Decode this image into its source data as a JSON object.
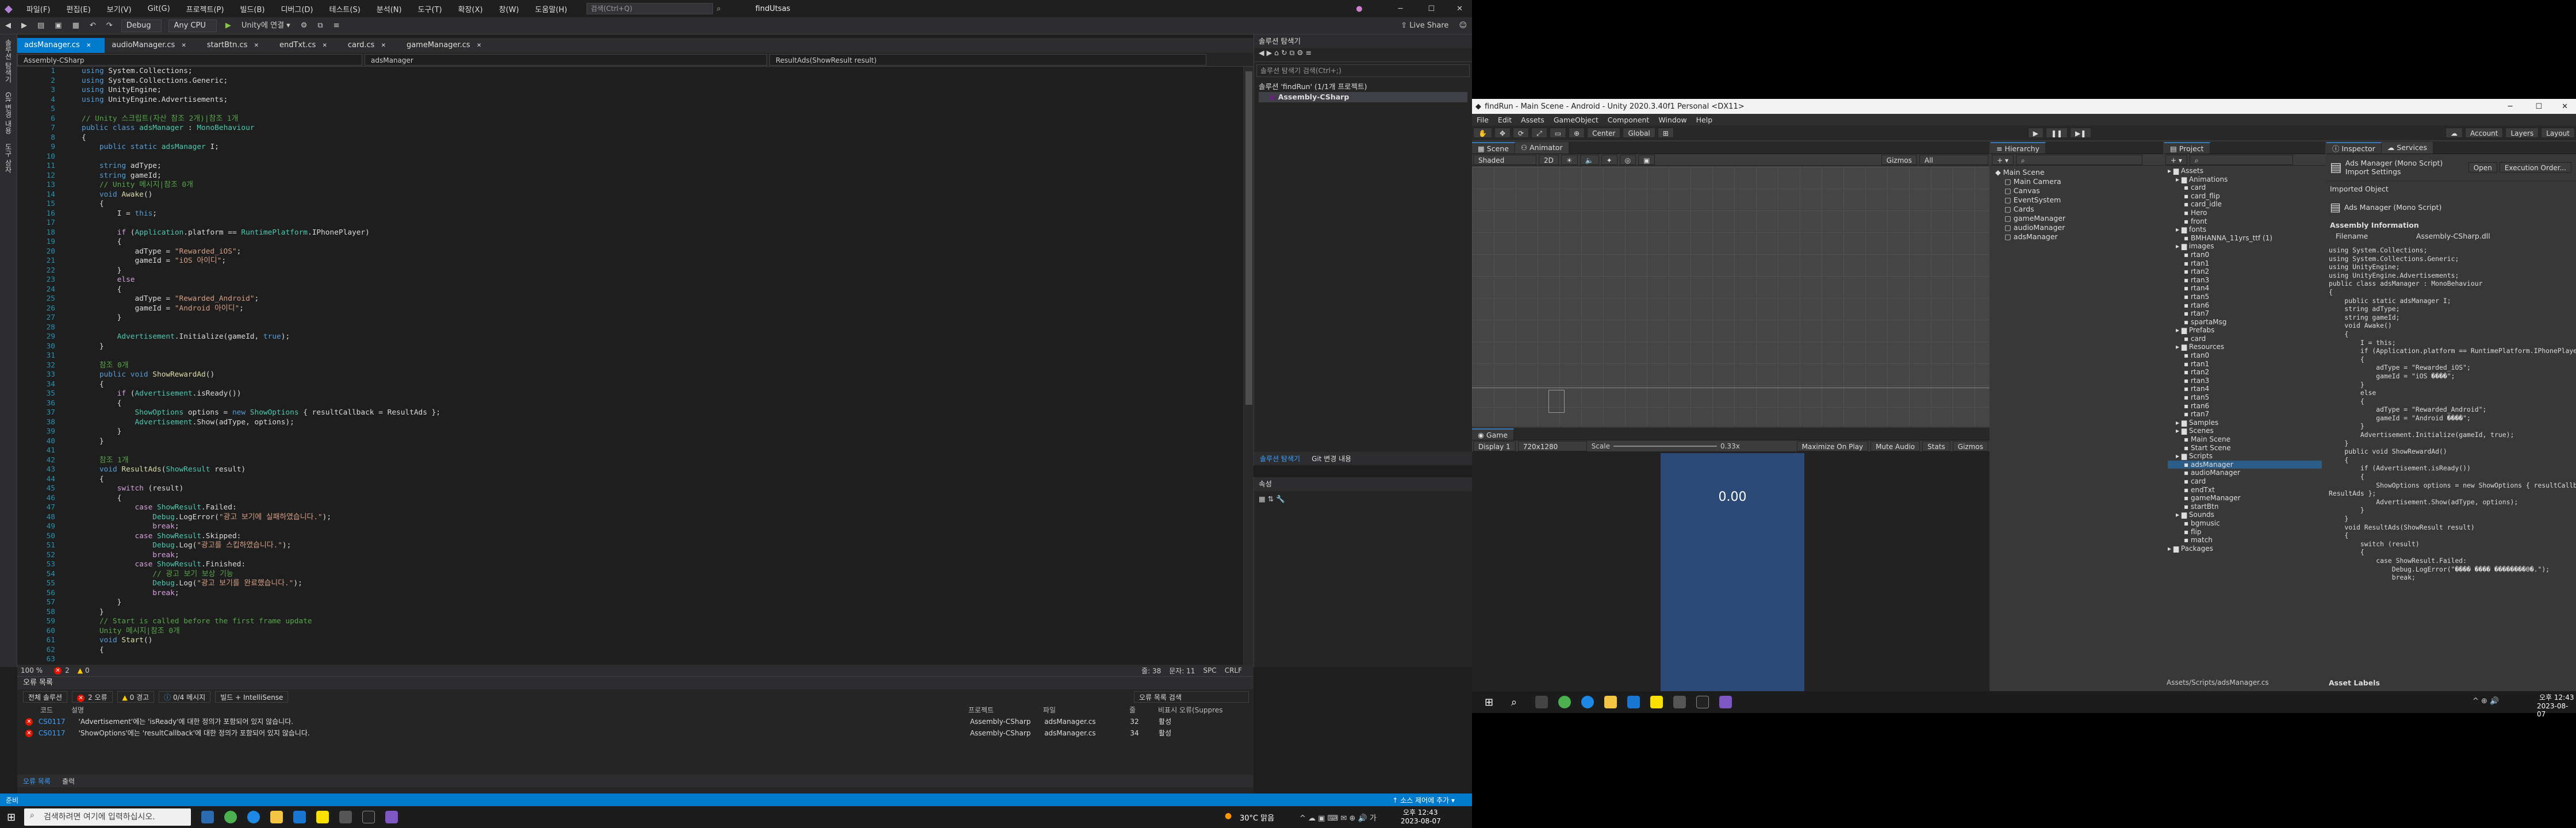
{
  "vs": {
    "title": "findUtsas",
    "menu": [
      "파일(F)",
      "편집(E)",
      "보기(V)",
      "Git(G)",
      "프로젝트(P)",
      "빌드(B)",
      "디버그(D)",
      "테스트(S)",
      "분석(N)",
      "도구(T)",
      "확장(X)",
      "창(W)",
      "도움말(H)"
    ],
    "search_placeholder": "검색(Ctrl+Q)",
    "toolbar": {
      "config": "Debug",
      "platform": "Any CPU",
      "attach": "Unity에 연결 ▾",
      "live_share": "Live Share"
    },
    "side_tabs": [
      "솔루션 탐색기",
      "Git 변경 내용",
      "도구 상자"
    ],
    "tabs": [
      "adsManager.cs",
      "audioManager.cs",
      "startBtn.cs",
      "endTxt.cs",
      "card.cs",
      "gameManager.cs"
    ],
    "nav": {
      "project": "Assembly-CSharp",
      "class": "adsManager",
      "member": "ResultAds(ShowResult result)"
    },
    "line_count": 63,
    "code_lines": [
      [
        [
          "k",
          "using "
        ],
        [
          "",
          "System.Collections;"
        ]
      ],
      [
        [
          "k",
          "using "
        ],
        [
          "",
          "System.Collections.Generic;"
        ]
      ],
      [
        [
          "k",
          "using "
        ],
        [
          "",
          "UnityEngine;"
        ]
      ],
      [
        [
          "k",
          "using "
        ],
        [
          "",
          "UnityEngine.Advertisements;"
        ]
      ],
      [
        [
          "",
          ""
        ]
      ],
      [
        [
          "c",
          "// Unity 스크립트(자산 참조 2개)|참조 1개"
        ]
      ],
      [
        [
          "k",
          "public class "
        ],
        [
          "t",
          "adsManager"
        ],
        [
          "",
          " : "
        ],
        [
          "t",
          "MonoBehaviour"
        ]
      ],
      [
        [
          "",
          "{"
        ]
      ],
      [
        [
          "",
          "    "
        ],
        [
          "k",
          "public static "
        ],
        [
          "t",
          "adsManager "
        ],
        [
          "",
          "I;"
        ]
      ],
      [
        [
          "",
          ""
        ]
      ],
      [
        [
          "",
          "    "
        ],
        [
          "k",
          "string "
        ],
        [
          "",
          "adType;"
        ]
      ],
      [
        [
          "",
          "    "
        ],
        [
          "k",
          "string "
        ],
        [
          "",
          "gameId;"
        ]
      ],
      [
        [
          "c",
          "    // Unity 메시지|참조 0개"
        ]
      ],
      [
        [
          "",
          "    "
        ],
        [
          "k",
          "void "
        ],
        [
          "m",
          "Awake"
        ],
        [
          "",
          "()"
        ]
      ],
      [
        [
          "",
          "    {"
        ]
      ],
      [
        [
          "",
          "        I = "
        ],
        [
          "k",
          "this"
        ],
        [
          "",
          ";"
        ]
      ],
      [
        [
          "",
          ""
        ]
      ],
      [
        [
          "",
          "        "
        ],
        [
          "p",
          "if "
        ],
        [
          "",
          "("
        ],
        [
          "t",
          "Application"
        ],
        [
          "",
          ".platform == "
        ],
        [
          "t",
          "RuntimePlatform"
        ],
        [
          "",
          ".IPhonePlayer)"
        ]
      ],
      [
        [
          "",
          "        {"
        ]
      ],
      [
        [
          "",
          "            adType = "
        ],
        [
          "s",
          "\"Rewarded_iOS\""
        ],
        [
          "",
          ";"
        ]
      ],
      [
        [
          "",
          "            gameId = "
        ],
        [
          "s",
          "\"iOS 아이디\""
        ],
        [
          "",
          ";"
        ]
      ],
      [
        [
          "",
          "        }"
        ]
      ],
      [
        [
          "",
          "        "
        ],
        [
          "p",
          "else"
        ]
      ],
      [
        [
          "",
          "        {"
        ]
      ],
      [
        [
          "",
          "            adType = "
        ],
        [
          "s",
          "\"Rewarded_Android\""
        ],
        [
          "",
          ";"
        ]
      ],
      [
        [
          "",
          "            gameId = "
        ],
        [
          "s",
          "\"Android 아이디\""
        ],
        [
          "",
          ";"
        ]
      ],
      [
        [
          "",
          "        }"
        ]
      ],
      [
        [
          "",
          ""
        ]
      ],
      [
        [
          "",
          "        "
        ],
        [
          "t",
          "Advertisement"
        ],
        [
          "",
          ".Initialize(gameId, "
        ],
        [
          "k",
          "true"
        ],
        [
          "",
          ");"
        ]
      ],
      [
        [
          "",
          "    }"
        ]
      ],
      [
        [
          "",
          ""
        ]
      ],
      [
        [
          "c",
          "    참조 0개"
        ]
      ],
      [
        [
          "",
          "    "
        ],
        [
          "k",
          "public void "
        ],
        [
          "m",
          "ShowRewardAd"
        ],
        [
          "",
          "()"
        ]
      ],
      [
        [
          "",
          "    {"
        ]
      ],
      [
        [
          "",
          "        "
        ],
        [
          "p",
          "if "
        ],
        [
          "",
          "("
        ],
        [
          "t",
          "Advertisement"
        ],
        [
          "",
          ".isReady())"
        ]
      ],
      [
        [
          "",
          "        {"
        ]
      ],
      [
        [
          "",
          "            "
        ],
        [
          "t",
          "ShowOptions "
        ],
        [
          "",
          "options = "
        ],
        [
          "k",
          "new "
        ],
        [
          "t",
          "ShowOptions "
        ],
        [
          "",
          "{ resultCallback = ResultAds };"
        ]
      ],
      [
        [
          "",
          "            "
        ],
        [
          "t",
          "Advertisement"
        ],
        [
          "",
          ".Show(adType, options);"
        ]
      ],
      [
        [
          "",
          "        }"
        ]
      ],
      [
        [
          "",
          "    }"
        ]
      ],
      [
        [
          "",
          ""
        ]
      ],
      [
        [
          "c",
          "    참조 1개"
        ]
      ],
      [
        [
          "",
          "    "
        ],
        [
          "k",
          "void "
        ],
        [
          "m",
          "ResultAds"
        ],
        [
          "",
          "("
        ],
        [
          "t",
          "ShowResult "
        ],
        [
          "",
          "result)"
        ]
      ],
      [
        [
          "",
          "    {"
        ]
      ],
      [
        [
          "",
          "        "
        ],
        [
          "p",
          "switch "
        ],
        [
          "",
          "(result)"
        ]
      ],
      [
        [
          "",
          "        {"
        ]
      ],
      [
        [
          "",
          "            "
        ],
        [
          "p",
          "case "
        ],
        [
          "t",
          "ShowResult"
        ],
        [
          "",
          ".Failed:"
        ]
      ],
      [
        [
          "",
          "                "
        ],
        [
          "t",
          "Debug"
        ],
        [
          "",
          ".LogError("
        ],
        [
          "s",
          "\"광고 보기에 실패하였습니다.\""
        ],
        [
          "",
          ");"
        ]
      ],
      [
        [
          "",
          "                "
        ],
        [
          "p",
          "break"
        ],
        [
          "",
          ";"
        ]
      ],
      [
        [
          "",
          "            "
        ],
        [
          "p",
          "case "
        ],
        [
          "t",
          "ShowResult"
        ],
        [
          "",
          ".Skipped:"
        ]
      ],
      [
        [
          "",
          "                "
        ],
        [
          "t",
          "Debug"
        ],
        [
          "",
          ".Log("
        ],
        [
          "s",
          "\"광고를 스킵하였습니다.\""
        ],
        [
          "",
          ");"
        ]
      ],
      [
        [
          "",
          "                "
        ],
        [
          "p",
          "break"
        ],
        [
          "",
          ";"
        ]
      ],
      [
        [
          "",
          "            "
        ],
        [
          "p",
          "case "
        ],
        [
          "t",
          "ShowResult"
        ],
        [
          "",
          ".Finished:"
        ]
      ],
      [
        [
          "c",
          "                // 광고 보기 보상 기능"
        ]
      ],
      [
        [
          "",
          "                "
        ],
        [
          "t",
          "Debug"
        ],
        [
          "",
          ".Log("
        ],
        [
          "s",
          "\"광고 보기를 완료했습니다.\""
        ],
        [
          "",
          ");"
        ]
      ],
      [
        [
          "",
          "                "
        ],
        [
          "p",
          "break"
        ],
        [
          "",
          ";"
        ]
      ],
      [
        [
          "",
          "        }"
        ]
      ],
      [
        [
          "",
          "    }"
        ]
      ],
      [
        [
          "c",
          "    // Start is called before the first frame update"
        ]
      ],
      [
        [
          "c",
          "    Unity 메시지|참조 0개"
        ]
      ],
      [
        [
          "",
          "    "
        ],
        [
          "k",
          "void "
        ],
        [
          "m",
          "Start"
        ],
        [
          "",
          "()"
        ]
      ],
      [
        [
          "",
          "    {"
        ]
      ],
      [
        [
          "",
          ""
        ]
      ],
      [
        [
          "",
          "    }"
        ]
      ]
    ],
    "editor_status": {
      "zoom": "100 %",
      "errors": "2",
      "warnings": "0",
      "line": "줄: 38",
      "col": "문자: 11",
      "enc": "SPC",
      "eol": "CRLF"
    },
    "errors": {
      "title": "오류 목록",
      "scope": "전체 솔루션",
      "err_count": "2 오류",
      "warn_count": "0 경고",
      "msg_count": "0/4 메시지",
      "build": "빌드 + IntelliSense",
      "search_placeholder": "오류 목록 검색",
      "cols": [
        "코드",
        "설명",
        "프로젝트",
        "파일",
        "줄",
        "비표시 오류(Suppres"
      ],
      "rows": [
        {
          "code": "CS0117",
          "desc": "'Advertisement'에는 'isReady'에 대한 정의가 포함되어 있지 않습니다.",
          "proj": "Assembly-CSharp",
          "file": "adsManager.cs",
          "line": "32",
          "state": "활성"
        },
        {
          "code": "CS0117",
          "desc": "'ShowOptions'에는 'resultCallback'에 대한 정의가 포함되어 있지 않습니다.",
          "proj": "Assembly-CSharp",
          "file": "adsManager.cs",
          "line": "34",
          "state": "활성"
        }
      ],
      "bottom_tabs": [
        "오류 목록",
        "출력"
      ]
    },
    "solution": {
      "title": "솔루션 탐색기",
      "search": "솔루션 탐색기 검색(Ctrl+;)",
      "root": "솔루션 'findRun' (1/1개 프로젝트)",
      "project": "Assembly-CSharp",
      "tabs": [
        "솔루션 탐색기",
        "Git 변경 내용"
      ]
    },
    "properties": {
      "title": "속성"
    },
    "status": {
      "left": "준비",
      "right": "↑ 소스 제어에 추가 ▾"
    }
  },
  "taskbar_left": {
    "search": "검색하려면 여기에 입력하십시오.",
    "weather": "30°C 맑음",
    "time": "오후 12:43",
    "date": "2023-08-07"
  },
  "unity": {
    "title": "findRun - Main Scene - Android - Unity 2020.3.40f1 Personal <DX11>",
    "menu": [
      "File",
      "Edit",
      "Assets",
      "GameObject",
      "Component",
      "Window",
      "Help"
    ],
    "tools": {
      "center": "Center",
      "global": "Global",
      "account": "Account",
      "layers": "Layers",
      "layout": "Layout"
    },
    "scene_tabs": [
      "Scene",
      "Animator"
    ],
    "scene_bar": {
      "shading": "Shaded",
      "mode": "2D",
      "gizmos": "Gizmos",
      "search": "All"
    },
    "game": {
      "tab": "Game",
      "display": "Display 1",
      "res": "720x1280",
      "scale_label": "Scale",
      "scale": "0.33x",
      "maximize": "Maximize On Play",
      "mute": "Mute Audio",
      "stats": "Stats",
      "gizmos": "Gizmos",
      "score": "0.00"
    },
    "hierarchy": {
      "title": "Hierarchy",
      "items": [
        {
          "t": "Main Scene",
          "d": 0
        },
        {
          "t": "Main Camera",
          "d": 1
        },
        {
          "t": "Canvas",
          "d": 1
        },
        {
          "t": "EventSystem",
          "d": 1
        },
        {
          "t": "Cards",
          "d": 1
        },
        {
          "t": "gameManager",
          "d": 1
        },
        {
          "t": "audioManager",
          "d": 1
        },
        {
          "t": "adsManager",
          "d": 1
        }
      ]
    },
    "project": {
      "title": "Project",
      "items": [
        {
          "t": "Assets",
          "d": 0
        },
        {
          "t": "Animations",
          "d": 1
        },
        {
          "t": "card",
          "d": 2
        },
        {
          "t": "card_flip",
          "d": 2
        },
        {
          "t": "card_idle",
          "d": 2
        },
        {
          "t": "Hero",
          "d": 2
        },
        {
          "t": "front",
          "d": 2
        },
        {
          "t": "fonts",
          "d": 1
        },
        {
          "t": "BMHANNA_11yrs_ttf (1)",
          "d": 2
        },
        {
          "t": "images",
          "d": 1
        },
        {
          "t": "rtan0",
          "d": 2
        },
        {
          "t": "rtan1",
          "d": 2
        },
        {
          "t": "rtan2",
          "d": 2
        },
        {
          "t": "rtan3",
          "d": 2
        },
        {
          "t": "rtan4",
          "d": 2
        },
        {
          "t": "rtan5",
          "d": 2
        },
        {
          "t": "rtan6",
          "d": 2
        },
        {
          "t": "rtan7",
          "d": 2
        },
        {
          "t": "spartaMsg",
          "d": 2
        },
        {
          "t": "Prefabs",
          "d": 1
        },
        {
          "t": "card",
          "d": 2
        },
        {
          "t": "Resources",
          "d": 1
        },
        {
          "t": "rtan0",
          "d": 2
        },
        {
          "t": "rtan1",
          "d": 2
        },
        {
          "t": "rtan2",
          "d": 2
        },
        {
          "t": "rtan3",
          "d": 2
        },
        {
          "t": "rtan4",
          "d": 2
        },
        {
          "t": "rtan5",
          "d": 2
        },
        {
          "t": "rtan6",
          "d": 2
        },
        {
          "t": "rtan7",
          "d": 2
        },
        {
          "t": "Samples",
          "d": 1
        },
        {
          "t": "Scenes",
          "d": 1
        },
        {
          "t": "Main Scene",
          "d": 2
        },
        {
          "t": "Start Scene",
          "d": 2
        },
        {
          "t": "Scripts",
          "d": 1
        },
        {
          "t": "adsManager",
          "d": 2
        },
        {
          "t": "audioManager",
          "d": 2
        },
        {
          "t": "card",
          "d": 2
        },
        {
          "t": "endTxt",
          "d": 2
        },
        {
          "t": "gameManager",
          "d": 2
        },
        {
          "t": "startBtn",
          "d": 2
        },
        {
          "t": "Sounds",
          "d": 1
        },
        {
          "t": "bgmusic",
          "d": 2
        },
        {
          "t": "flip",
          "d": 2
        },
        {
          "t": "match",
          "d": 2
        },
        {
          "t": "Packages",
          "d": 0
        }
      ],
      "path": "Assets/Scripts/adsManager.cs"
    },
    "inspector": {
      "title": "Inspector",
      "services": "Services",
      "header": "Ads Manager (Mono Script) Import Settings",
      "open": "Open",
      "exec": "Execution Order...",
      "imported": "Imported Object",
      "script_name": "Ads Manager (Mono Script)",
      "asm_title": "Assembly Information",
      "filename_label": "Filename",
      "filename": "Assembly-CSharp.dll",
      "asset_labels": "Asset Labels",
      "code": [
        "using System.Collections;",
        "using System.Collections.Generic;",
        "using UnityEngine;",
        "using UnityEngine.Advertisements;",
        "",
        "public class adsManager : MonoBehaviour",
        "{",
        "    public static adsManager I;",
        "",
        "    string adType;",
        "    string gameId;",
        "    void Awake()",
        "    {",
        "        I = this;",
        "",
        "        if (Application.platform == RuntimePlatform.IPhonePlayer)",
        "        {",
        "            adType = \"Rewarded_iOS\";",
        "            gameId = \"iOS ����\";",
        "        }",
        "        else",
        "        {",
        "            adType = \"Rewarded_Android\";",
        "            gameId = \"Android ����\";",
        "        }",
        "",
        "        Advertisement.Initialize(gameId, true);",
        "    }",
        "",
        "    public void ShowRewardAd()",
        "    {",
        "        if (Advertisement.isReady())",
        "        {",
        "            ShowOptions options = new ShowOptions { resultCallback =",
        "ResultAds };",
        "            Advertisement.Show(adType, options);",
        "        }",
        "    }",
        "",
        "    void ResultAds(ShowResult result)",
        "    {",
        "        switch (result)",
        "        {",
        "            case ShowResult.Failed:",
        "                Debug.LogError(\"���� ���� ��������ϴ�.\");",
        "                break;"
      ]
    },
    "clock": {
      "time": "오후 12:43",
      "date": "2023-08-07"
    }
  }
}
